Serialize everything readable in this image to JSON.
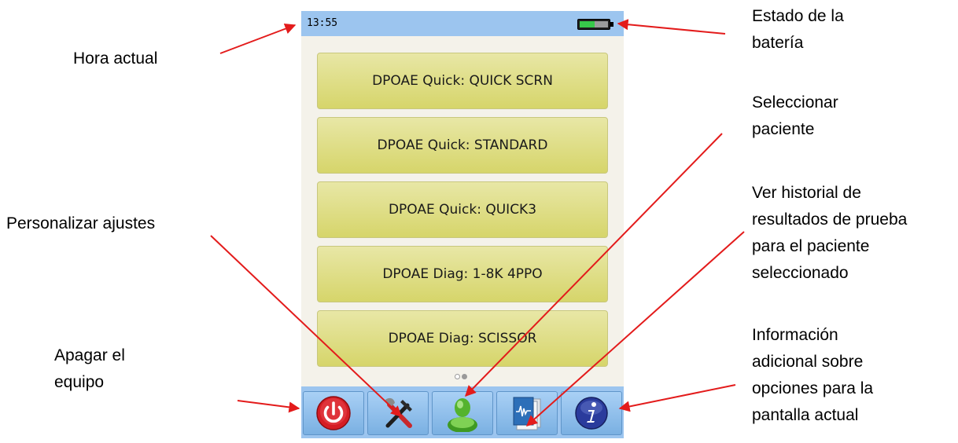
{
  "annotations": {
    "hora_actual": "Hora actual",
    "estado_bateria": "Estado de la\nbatería",
    "seleccionar_paciente": "Seleccionar\npaciente",
    "ver_historial": "Ver historial de\nresultados de prueba\npara el  paciente\nseleccionado",
    "personalizar": "Personalizar ajustes",
    "apagar": "Apagar el\nequipo",
    "informacion": "Información\nadicional sobre\nopciones para la\npantalla actual"
  },
  "device": {
    "status_bar": {
      "time": "13:55",
      "battery_icon": "battery-icon"
    },
    "protocols": [
      {
        "label": "DPOAE Quick: QUICK SCRN"
      },
      {
        "label": "DPOAE Quick: STANDARD"
      },
      {
        "label": "DPOAE Quick: QUICK3"
      },
      {
        "label": "DPOAE Diag: 1-8K 4PPO"
      },
      {
        "label": "DPOAE Diag: SCISSOR"
      }
    ],
    "pager": {
      "pages": 2,
      "current": 1
    },
    "toolbar": {
      "buttons": [
        {
          "icon": "power-icon"
        },
        {
          "icon": "tools-icon"
        },
        {
          "icon": "patient-icon"
        },
        {
          "icon": "history-icon"
        },
        {
          "icon": "info-icon"
        }
      ]
    }
  },
  "colors": {
    "status_bar": "#9cc5ef",
    "protocol_button": "#dcdb86",
    "arrow": "#e31b1b",
    "power": "#d51d24",
    "patient": "#54b32e",
    "info": "#2a3b9c"
  }
}
